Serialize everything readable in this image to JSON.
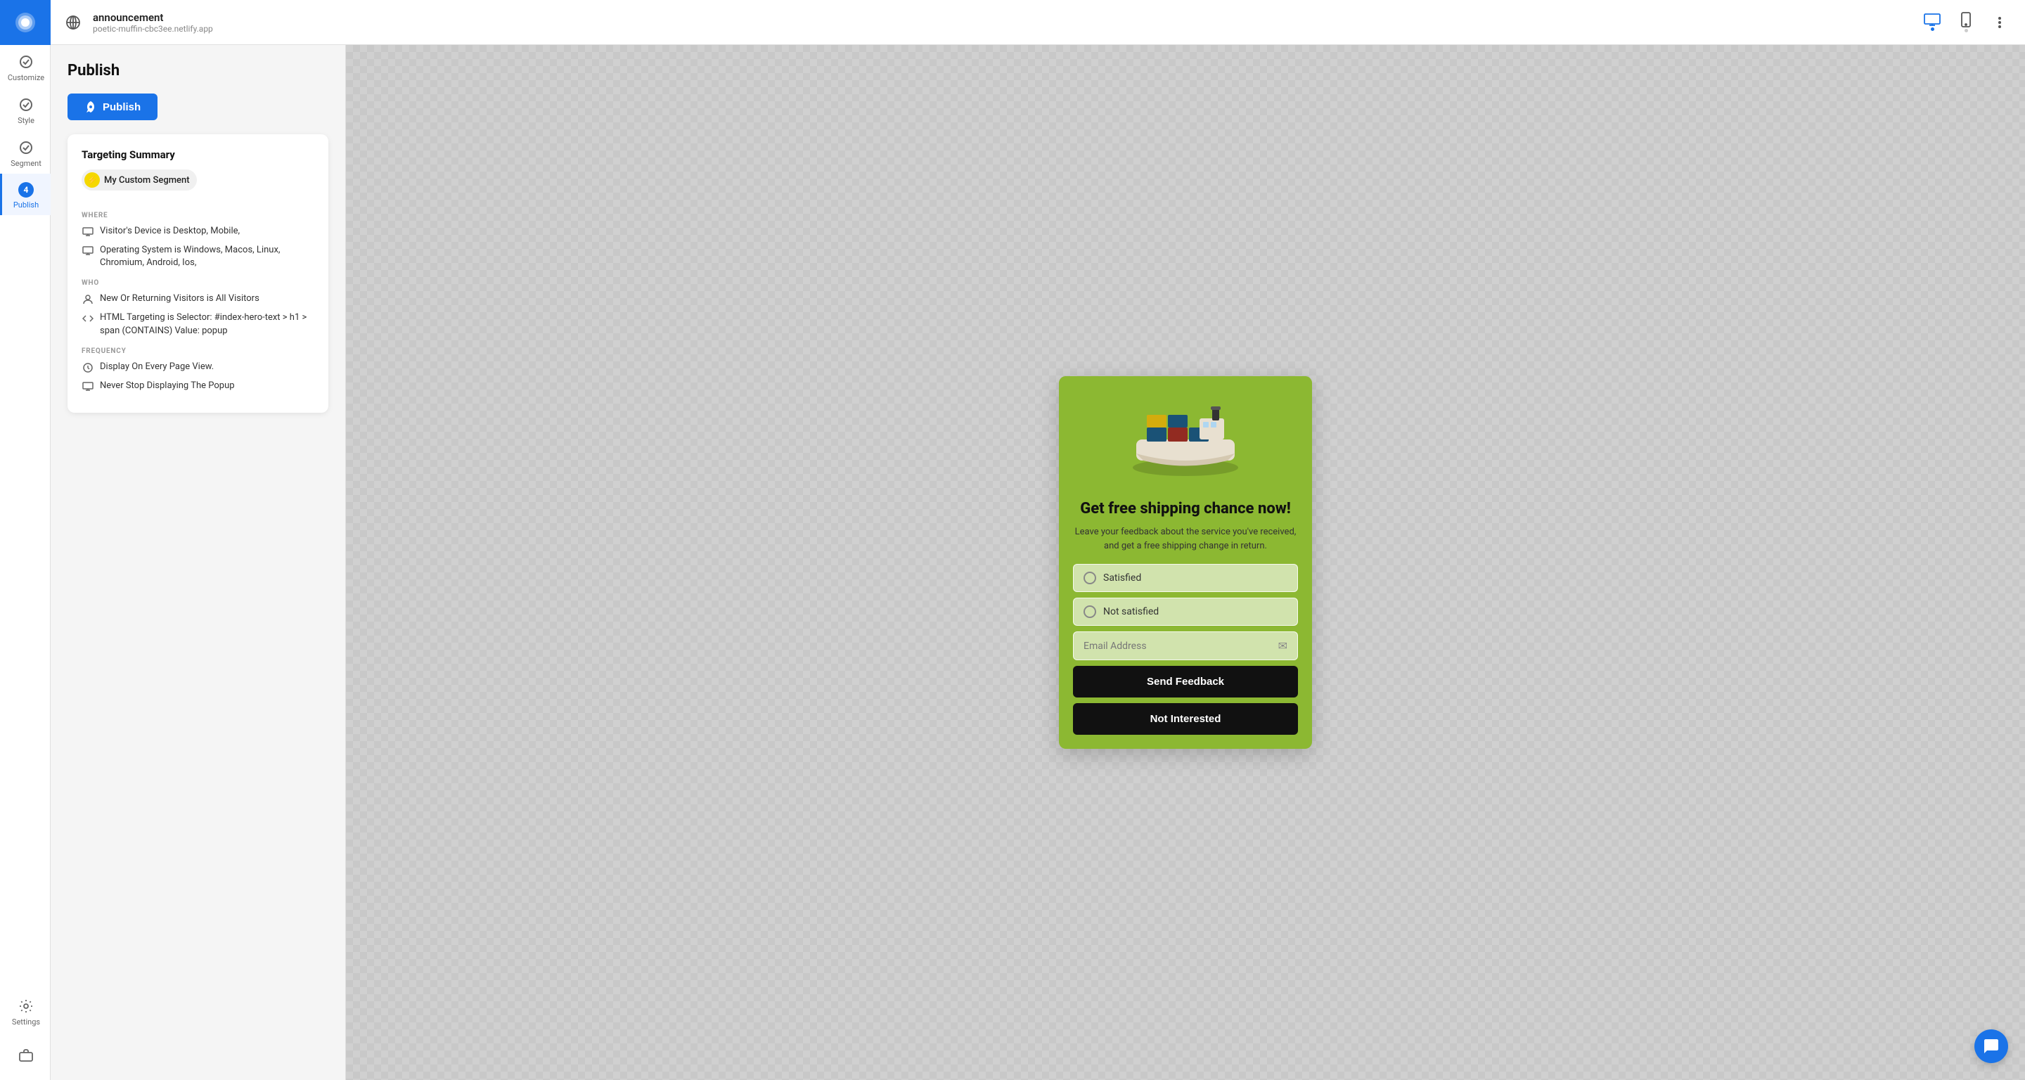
{
  "app": {
    "logo_label": "App Logo"
  },
  "topbar": {
    "site_name": "announcement",
    "site_url": "poetic-muffin-cbc3ee.netlify.app",
    "desktop_icon_label": "Desktop",
    "mobile_icon_label": "Mobile",
    "more_icon_label": "More options"
  },
  "sidebar": {
    "items": [
      {
        "id": "customize",
        "label": "Customize",
        "icon": "check"
      },
      {
        "id": "style",
        "label": "Style",
        "icon": "check"
      },
      {
        "id": "segment",
        "label": "Segment",
        "icon": "check"
      },
      {
        "id": "publish",
        "label": "Publish",
        "icon": "check",
        "active": true,
        "badge": "4"
      }
    ],
    "settings_label": "Settings",
    "briefcase_label": "Briefcase"
  },
  "publish_panel": {
    "title": "Publish",
    "publish_button_label": "Publish",
    "targeting_card": {
      "title": "Targeting Summary",
      "segment_name": "My Custom Segment",
      "where_label": "WHERE",
      "where_items": [
        {
          "icon": "monitor",
          "text": "Visitor's Device is Desktop, Mobile,"
        },
        {
          "icon": "monitor",
          "text": "Operating System is Windows, Macos, Linux, Chromium, Android, Ios,"
        }
      ],
      "who_label": "WHO",
      "who_items": [
        {
          "icon": "person",
          "text": "New Or Returning Visitors is All Visitors"
        },
        {
          "icon": "code",
          "text": "HTML Targeting is Selector: #index-hero-text > h1 > span (CONTAINS) Value: popup"
        }
      ],
      "frequency_label": "FREQUENCY",
      "frequency_items": [
        {
          "icon": "clock",
          "text": "Display On Every Page View."
        },
        {
          "icon": "monitor",
          "text": "Never Stop Displaying The Popup"
        }
      ]
    }
  },
  "popup": {
    "heading": "Get free shipping chance now!",
    "subtext": "Leave your feedback about the service you've received, and get a free shipping change in return.",
    "option1": "Satisfied",
    "option2": "Not satisfied",
    "email_placeholder": "Email Address",
    "send_button": "Send Feedback",
    "not_interested_button": "Not Interested"
  }
}
